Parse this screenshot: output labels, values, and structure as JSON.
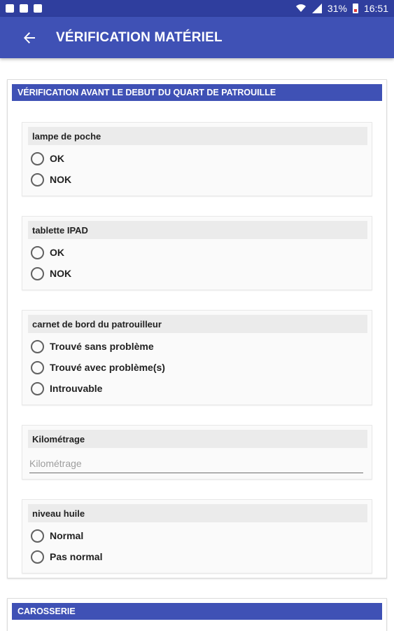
{
  "status_bar": {
    "battery": "31%",
    "time": "16:51"
  },
  "app_bar": {
    "title": "VÉRIFICATION MATÉRIEL"
  },
  "sections": [
    {
      "title": "VÉRIFICATION AVANT LE DEBUT DU QUART DE PATROUILLE",
      "cards": [
        {
          "label": "lampe de poche",
          "options": [
            "OK",
            "NOK"
          ]
        },
        {
          "label": "tablette IPAD",
          "options": [
            "OK",
            "NOK"
          ]
        },
        {
          "label": "carnet de bord du patrouilleur",
          "options": [
            "Trouvé sans problème",
            "Trouvé avec problème(s)",
            "Introuvable"
          ]
        },
        {
          "label": "Kilométrage",
          "placeholder": "Kilométrage"
        },
        {
          "label": "niveau huile",
          "options": [
            "Normal",
            "Pas normal"
          ]
        }
      ]
    },
    {
      "title": "CAROSSERIE"
    }
  ]
}
